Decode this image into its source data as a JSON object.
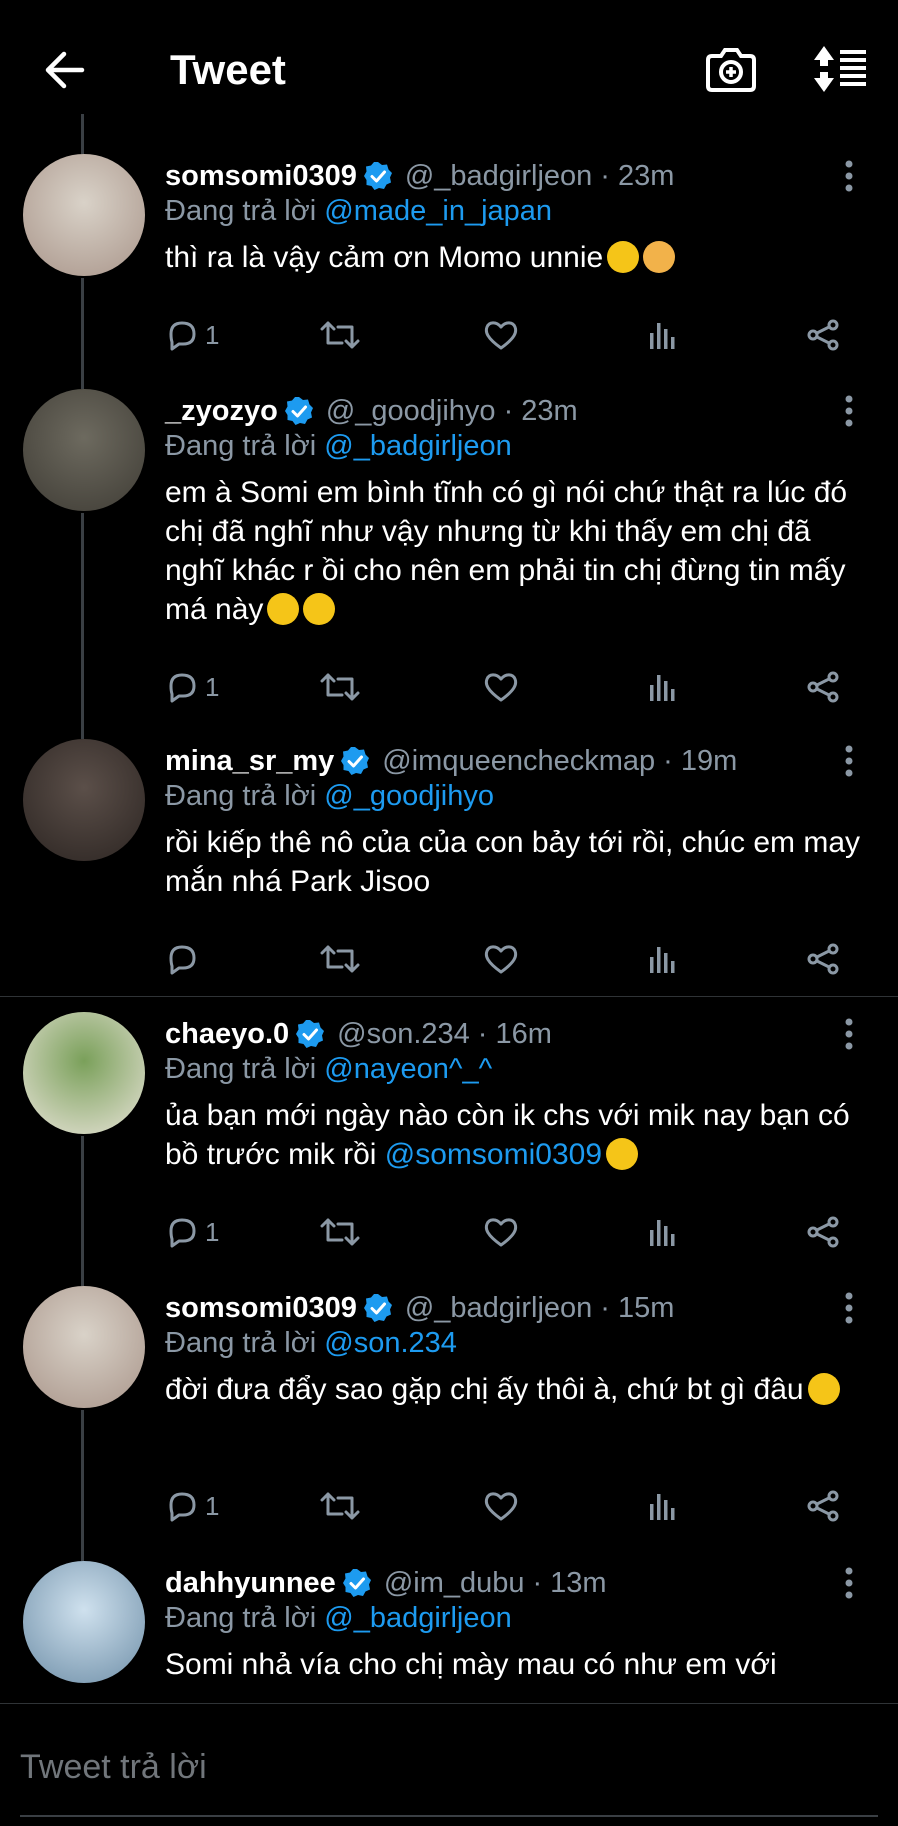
{
  "header": {
    "title": "Tweet"
  },
  "tweets": [
    {
      "name": "somsomi0309",
      "handle": "@_badgirljeon",
      "time": "23m",
      "reply_label": "Đang trả lời",
      "reply_to": "@made_in_japan",
      "text": "thì ra là vậy cảm ơn Momo unnie",
      "emojis": [
        "grin-emoji",
        "thumbs-up-emoji"
      ],
      "reply_count": "1"
    },
    {
      "name": "_zyozyo",
      "handle": "@_goodjihyo",
      "time": "23m",
      "reply_label": "Đang trả lời",
      "reply_to": "@_badgirljeon",
      "text": "em à Somi em bình tĩnh có gì nói chứ thật ra lúc đó chị đã nghĩ như vậy nhưng từ khi thấy em chị đã nghĩ khác r ồi cho nên em phải tin chị đừng tin mấy má này",
      "emojis": [
        "pleading-emoji",
        "confounded-emoji"
      ],
      "reply_count": "1"
    },
    {
      "name": "mina_sr_my",
      "handle": "@imqueencheckmap",
      "time": "19m",
      "reply_label": "Đang trả lời",
      "reply_to": "@_goodjihyo",
      "text": "rồi kiếp thê nô của của con bảy tới rồi, chúc em may mắn nhá Park Jisoo",
      "emojis": [],
      "reply_count": ""
    },
    {
      "name": "chaeyo.0",
      "handle": "@son.234",
      "time": "16m",
      "reply_label": "Đang trả lời",
      "reply_to": "@nayeon^_^",
      "text": "ủa bạn mới ngày nào còn ik chs với mik nay bạn có bồ trước mik rồi ",
      "text_mention": "@somsomi0309",
      "emojis": [
        "smiling-tear-emoji"
      ],
      "reply_count": "1"
    },
    {
      "name": "somsomi0309",
      "handle": "@_badgirljeon",
      "time": "15m",
      "reply_label": "Đang trả lời",
      "reply_to": "@son.234",
      "text": "đời đưa đẩy sao gặp chị ấy thôi à, chứ bt gì đâu",
      "emojis": [
        "kissing-emoji"
      ],
      "reply_count": "1"
    },
    {
      "name": "dahhyunnee",
      "handle": "@im_dubu",
      "time": "13m",
      "reply_label": "Đang trả lời",
      "reply_to": "@_badgirljeon",
      "text": "Somi nhả vía cho chị mày mau có như em với",
      "emojis": [],
      "reply_count": ""
    }
  ],
  "compose": {
    "placeholder": "Tweet trả lời"
  },
  "colors": {
    "background": "#000000",
    "accent": "#1d9bf0",
    "muted": "#8b98a5",
    "text": "#ffffff"
  }
}
